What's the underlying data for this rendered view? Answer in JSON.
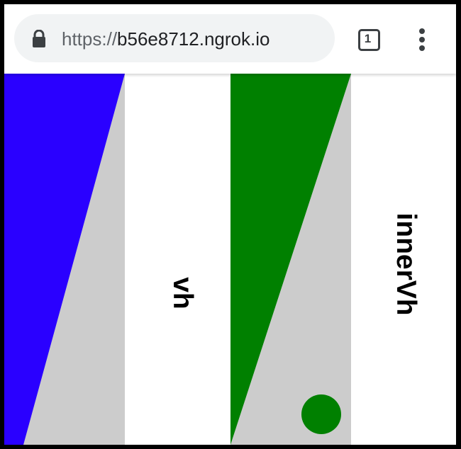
{
  "browser": {
    "url_scheme": "https://",
    "url_host": "b56e8712.ngrok.io",
    "tab_count": "1",
    "icons": {
      "lock": "lock-icon",
      "tabs": "tab-switcher-icon",
      "menu": "more-vert-icon"
    }
  },
  "page": {
    "left_label": "vh",
    "right_label": "innerVh",
    "colors": {
      "blue": "#2a00ff",
      "gray": "#cccccc",
      "green": "#008000",
      "white": "#ffffff"
    }
  }
}
